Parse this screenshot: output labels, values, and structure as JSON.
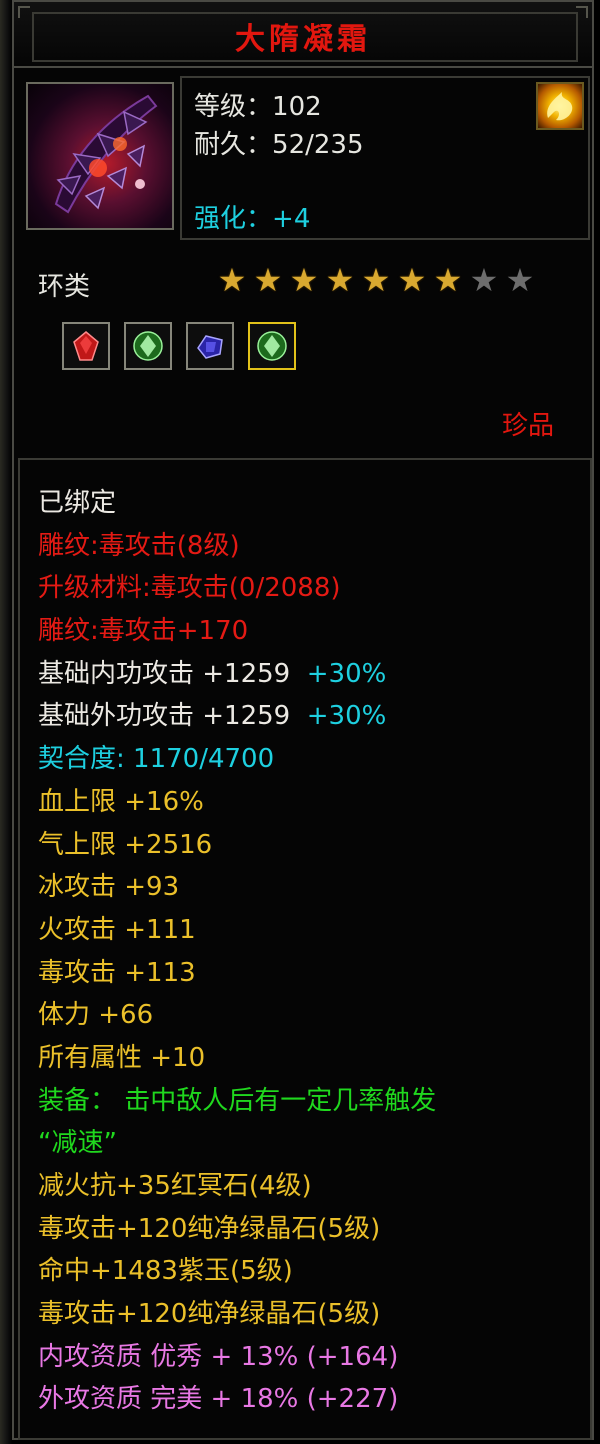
{
  "item": {
    "name": "大隋凝霜",
    "level_label": "等级",
    "level_value": "102",
    "durability_label": "耐久",
    "durability_value": "52/235",
    "enhance_label": "强化",
    "enhance_value": "+4",
    "separator": "：",
    "type": "环类",
    "rarity": "珍品",
    "stars": {
      "filled": 7,
      "total": 9
    }
  },
  "icons": {
    "item_image": "ring-icon",
    "badge": "golden-flame-badge-icon",
    "gems": [
      "red-gem-icon",
      "green-crystal-icon",
      "purple-jade-icon",
      "green-crystal-icon"
    ]
  },
  "attributes": {
    "bound": "已绑定",
    "engrave": "雕纹:毒攻击(8级)",
    "upgrade_material": "升级材料:毒攻击(0/2088)",
    "engrave_bonus": "雕纹:毒攻击+170",
    "inner_attack": {
      "label": "基础内功攻击 +1259",
      "bonus": "+30%"
    },
    "outer_attack": {
      "label": "基础外功攻击 +1259",
      "bonus": "+30%"
    },
    "fit": "契合度: 1170/4700",
    "stats": [
      "血上限 +16%",
      "气上限 +2516",
      "冰攻击 +93",
      "火攻击 +111",
      "毒攻击 +113",
      "体力 +66",
      "所有属性 +10"
    ],
    "equip_effect_line1": "装备： 击中敌人后有一定几率触发",
    "equip_effect_line2": "“减速”",
    "gem_effects": [
      "减火抗+35红冥石(4级)",
      "毒攻击+120纯净绿晶石(5级)",
      "命中+1483紫玉(5级)",
      "毒攻击+120纯净绿晶石(5级)"
    ],
    "aptitude_inner": "内攻资质 优秀 + 13% (+164)",
    "aptitude_outer": "外攻资质 完美 + 18% (+227)"
  },
  "colors": {
    "title": "#e2170f",
    "white": "#ece9e3",
    "red": "#e41a14",
    "cyan": "#1ed0e0",
    "gold": "#ebc02a",
    "green": "#20d81e",
    "pink": "#e878e4",
    "star_on": "#d9a930",
    "star_off": "#6d6d6d"
  }
}
